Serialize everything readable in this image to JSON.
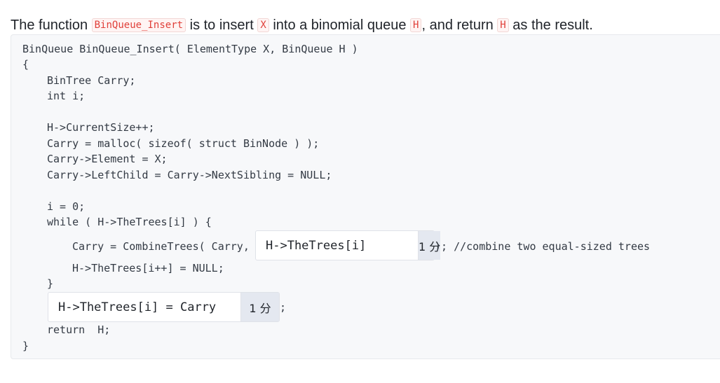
{
  "prompt": {
    "t1": "The function ",
    "fn": "BinQueue_Insert",
    "t2": " is to insert ",
    "x": "X",
    "t3": " into a binomial queue ",
    "h1": "H",
    "t4": ", and return ",
    "h2": "H",
    "t5": " as the result."
  },
  "code": {
    "line1": "BinQueue BinQueue_Insert( ElementType X, BinQueue H )",
    "line2": "{",
    "line3": "BinTree Carry;",
    "line4": "int i;",
    "line5": "H->CurrentSize++;",
    "line6": "Carry = malloc( sizeof( struct BinNode ) );",
    "line7": "Carry->Element = X;",
    "line8": "Carry->LeftChild = Carry->NextSibling = NULL;",
    "line9": "i = 0;",
    "line10": "while ( H->TheTrees[i] ) {",
    "line11_prefix": "Carry = CombineTrees( Carry,",
    "line11_suffix": "); //combine two equal-sized trees",
    "line12": "H->TheTrees[i++] = NULL;",
    "line13": "}",
    "line14_suffix": ";",
    "line15": "return  H;",
    "line16": "}"
  },
  "blanks": [
    {
      "value": "H->TheTrees[i]",
      "score": "1 分"
    },
    {
      "value": "H->TheTrees[i] = Carry",
      "score": "1 分"
    }
  ]
}
